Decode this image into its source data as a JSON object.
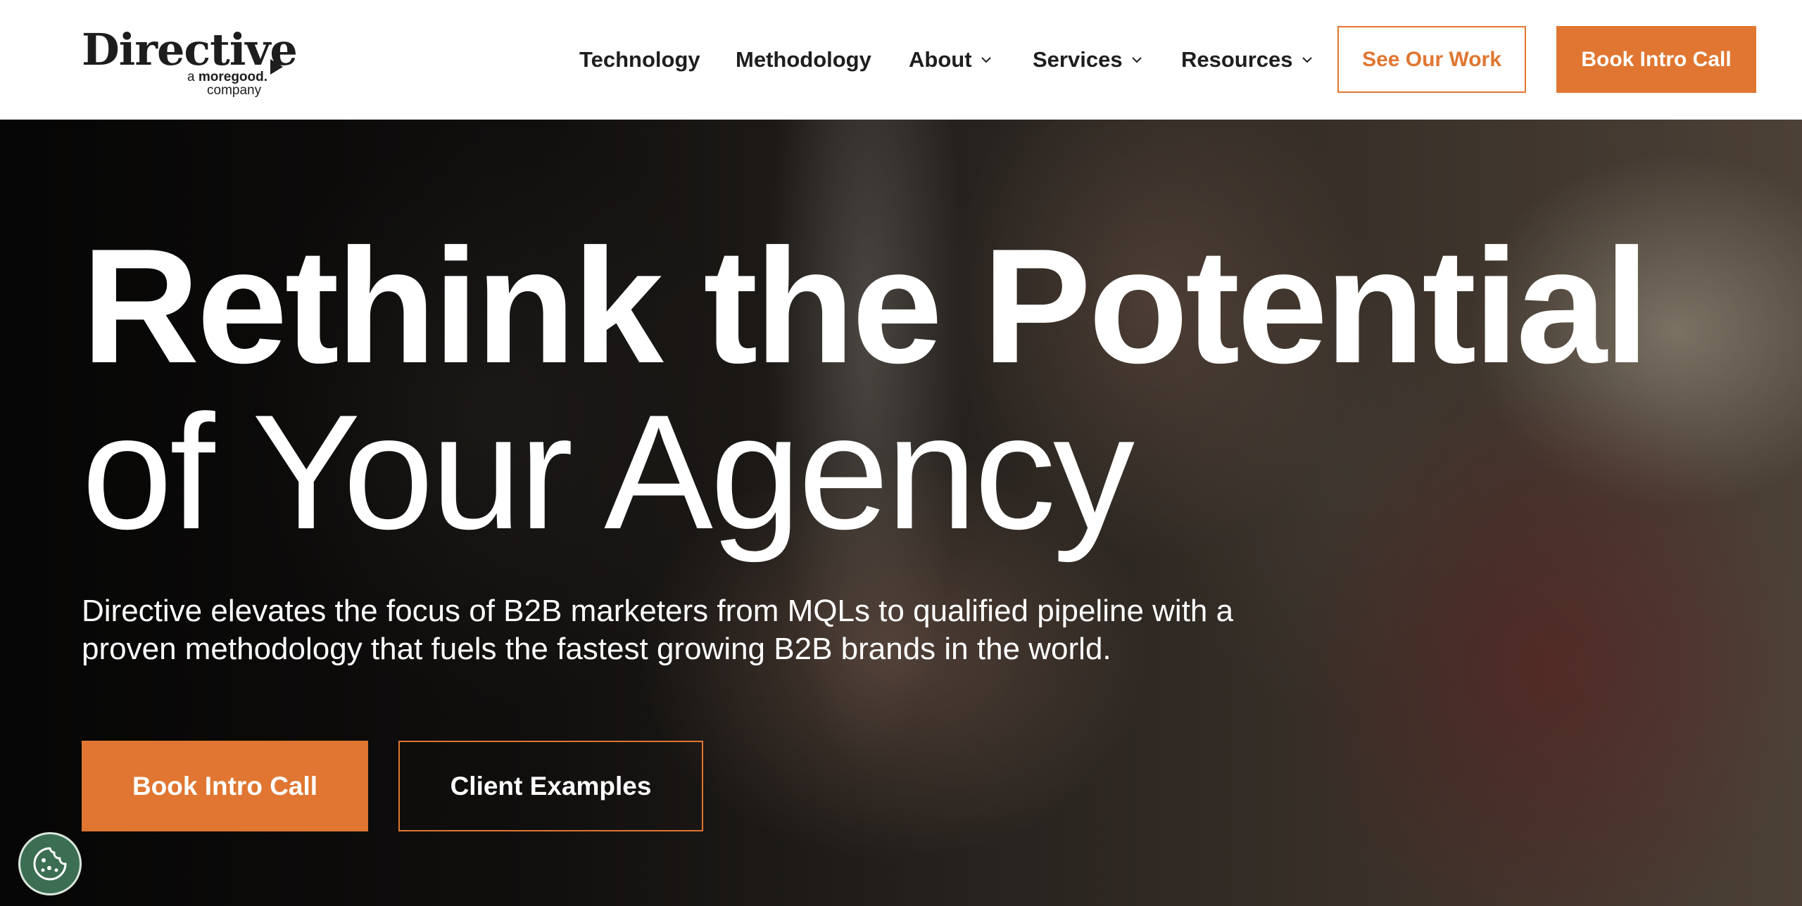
{
  "brand": {
    "name": "Directive",
    "tagline_prefix": "a",
    "tagline_brand": "moregood.",
    "tagline_suffix": "company"
  },
  "nav": {
    "items": [
      {
        "label": "Technology",
        "has_dropdown": false
      },
      {
        "label": "Methodology",
        "has_dropdown": false
      },
      {
        "label": "About",
        "has_dropdown": true
      },
      {
        "label": "Services",
        "has_dropdown": true
      },
      {
        "label": "Resources",
        "has_dropdown": true
      }
    ],
    "see_work_label": "See Our Work",
    "book_call_label": "Book Intro Call"
  },
  "hero": {
    "title_line1": "Rethink the Potential",
    "title_line2": "of Your Agency",
    "subtitle_line1": "Directive elevates the focus of B2B marketers from MQLs to qualified pipeline with a",
    "subtitle_line2": "proven methodology that fuels the fastest growing B2B brands in the world.",
    "primary_cta": "Book Intro Call",
    "secondary_cta": "Client Examples"
  },
  "colors": {
    "accent": "#e07631",
    "text_dark": "#1e1e1e",
    "cookie_bg": "#3b6e52"
  },
  "icons": {
    "dropdown": "chevron-down-icon",
    "cookie": "cookie-icon",
    "logo_arrow": "play-arrow-icon"
  }
}
